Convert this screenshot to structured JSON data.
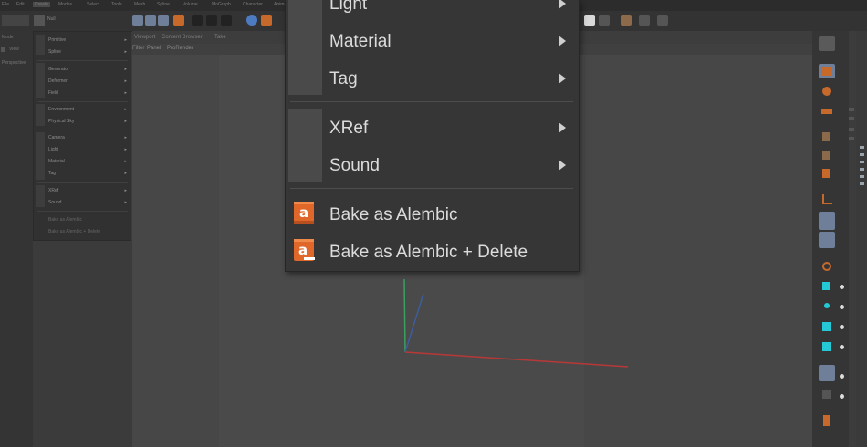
{
  "menu": {
    "items": [
      {
        "label": "Light",
        "has_submenu": true
      },
      {
        "label": "Material",
        "has_submenu": true
      },
      {
        "label": "Tag",
        "has_submenu": true
      },
      {
        "label": "XRef",
        "has_submenu": true
      },
      {
        "label": "Sound",
        "has_submenu": true
      },
      {
        "label": "Bake as Alembic",
        "icon": "alembic-icon"
      },
      {
        "label": "Bake as Alembic + Delete",
        "icon": "alembic-delete-icon"
      }
    ]
  },
  "background": {
    "menubar": [
      "File",
      "Edit",
      "Create",
      "Modes",
      "Select",
      "Tools",
      "Mesh",
      "Spline",
      "Volume",
      "MoGraph",
      "Character",
      "Animate"
    ],
    "search_value": "Null",
    "viewport_tabs": [
      "Viewport",
      "Content Browser",
      "Take"
    ],
    "viewport_menu": [
      "Filter",
      "Panel",
      "ProRender"
    ],
    "left_panel": [
      "Mode",
      "View",
      "Perspective"
    ],
    "create_menu": [
      "Primitive",
      "Spline",
      "Generator",
      "Deformer",
      "Field",
      "Environment",
      "Physical Sky",
      "Camera",
      "Light",
      "Material",
      "Tag",
      "XRef",
      "Sound",
      "Bake as Alembic",
      "Bake as Alembic + Delete"
    ]
  },
  "colors": {
    "menu_bg": "#363636",
    "menu_text": "#dcdcdc",
    "icon_orange": "#e0672a",
    "selected_icon_bg": "#6f7f9a",
    "axis_x": "#b83838",
    "axis_y": "#3aa060",
    "axis_z": "#3d5d9c"
  }
}
